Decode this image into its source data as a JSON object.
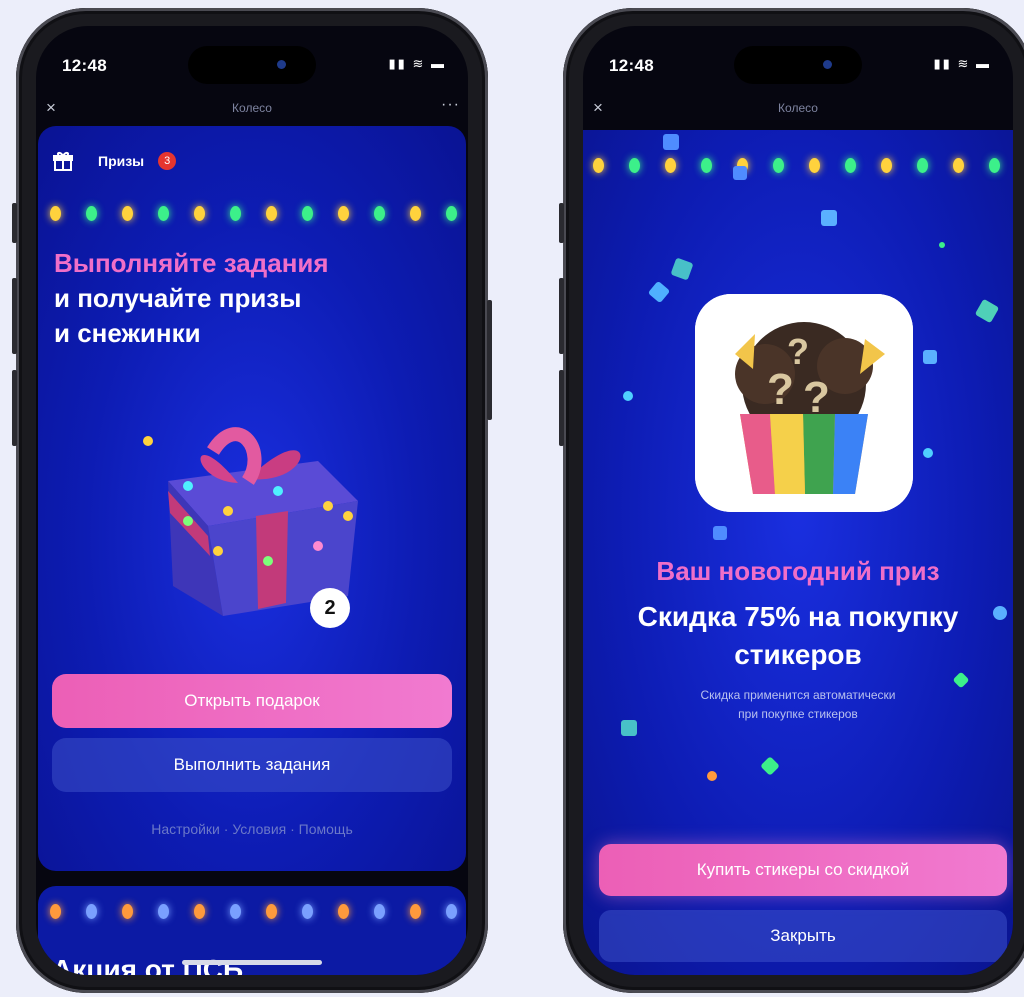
{
  "status": {
    "time": "12:48",
    "signal": "signal-icon",
    "wifi": "wifi-icon",
    "battery": "battery-icon"
  },
  "nav": {
    "title": "Колесо",
    "close": "×",
    "more": "···"
  },
  "left": {
    "prizes_label": "Призы",
    "prizes_badge": "3",
    "headline_pink": "Выполняйте задания",
    "headline_line2": "и получайте призы",
    "headline_line3": "и снежинки",
    "gift_count": "2",
    "open_gift_button": "Открыть подарок",
    "do_tasks_button": "Выполнить задания",
    "footer_links": "Настройки · Условия · Помощь",
    "promo_title": "Акция от ПСБ"
  },
  "right": {
    "prize_title": "Ваш новогодний приз",
    "prize_line1": "Скидка 75% на покупку",
    "prize_line2": "стикеров",
    "note_line1": "Скидка применится автоматически",
    "note_line2": "при покупке стикеров",
    "buy_button": "Купить стикеры со скидкой",
    "close_button": "Закрыть"
  },
  "colors": {
    "accent_pink": "#ec5fb6",
    "bg_blue": "#0d1cb3",
    "badge_red": "#e5352f"
  }
}
